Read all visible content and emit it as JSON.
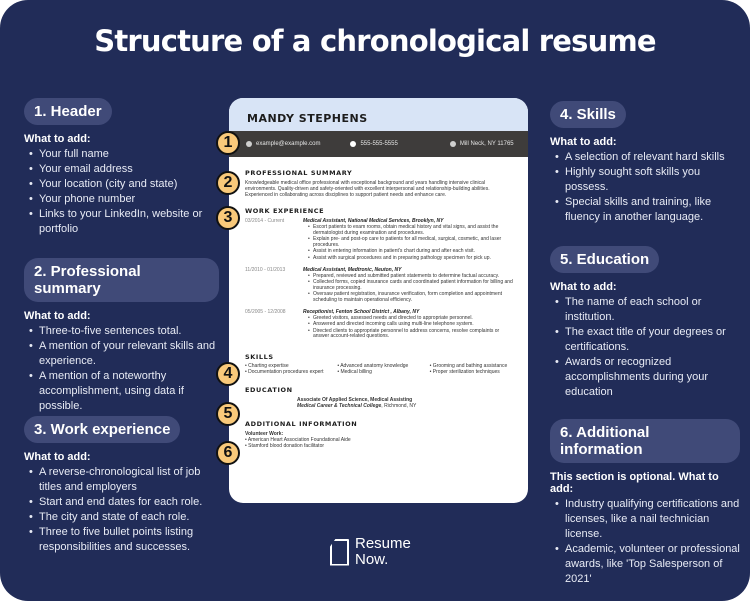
{
  "title": "Structure of a chronological resume",
  "panels": [
    {
      "heading": "1. Header",
      "intro": "What to add:",
      "items": [
        "Your full name",
        "Your email address",
        "Your location (city and state)",
        "Your phone number",
        "Links to your LinkedIn, website or portfolio"
      ]
    },
    {
      "heading": "2. Professional summary",
      "intro": "What to add:",
      "items": [
        "Three-to-five sentences total.",
        "A mention of your relevant skills and experience.",
        "A mention of a noteworthy accomplishment, using data if possible."
      ]
    },
    {
      "heading": "3. Work experience",
      "intro": "What to add:",
      "items": [
        "A reverse-chronological list of job titles and employers",
        "Start and end dates for each role.",
        "The city and state of each role.",
        "Three to five bullet points listing responsibilities and successes."
      ]
    },
    {
      "heading": "4. Skills",
      "intro": "What to add:",
      "items": [
        "A selection of relevant hard skills",
        "Highly sought soft skills you possess.",
        "Special skills and training, like fluency in another language."
      ]
    },
    {
      "heading": "5. Education",
      "intro": "What to add:",
      "items": [
        "The name of each school or institution.",
        "The exact title of your degrees or certifications.",
        "Awards or recognized accomplishments during your education"
      ]
    },
    {
      "heading": "6. Additional information",
      "intro": "This section is optional. What to add:",
      "items": [
        "Industry qualifying certifications and licenses, like a nail technician license.",
        "Academic, volunteer or professional awards, like 'Top Salesperson of 2021'"
      ]
    }
  ],
  "badges": [
    "1",
    "2",
    "3",
    "4",
    "5",
    "6"
  ],
  "resume": {
    "name": "MANDY STEPHENS",
    "email": "example@example.com",
    "phone": "555-555-5555",
    "location": "Mill Neck, NY 11765",
    "summary_heading": "PROFESSIONAL SUMMARY",
    "summary": "Knowledgeable medical office professional with exceptional background and years handling intensive clinical environments. Quality-driven and safety-oriented with excellent interpersonal and relationship-building abilities. Experienced in collaborating across disciplines to support patient needs and enhance care.",
    "work_heading": "WORK EXPERIENCE",
    "jobs": [
      {
        "dates": "03/2014 - Current",
        "title": "Medical Assistant, National Medical Services, Brooklyn, NY",
        "bullets": [
          "Escort patients to exam rooms, obtain medical history and vital signs, and assist the dermatologist during examination and procedures.",
          "Explain pre- and post-op care to patients for all medical, surgical, cosmetic, and laser procedures.",
          "Assist in entering information in patient's chart during and after each visit.",
          "Assist with surgical procedures and in preparing pathology specimen for pick up."
        ]
      },
      {
        "dates": "11/2010 - 01/2013",
        "title": "Medical Assistant, Medtronic, Neuton, NY",
        "bullets": [
          "Prepared, reviewed and submitted patient statements to determine factual accuracy.",
          "Collected forms, copied insurance cards and coordinated patient information for billing and insurance processing.",
          "Oversaw patient registration, insurance verification, form completion and appointment scheduling to maintain operational efficiency."
        ]
      },
      {
        "dates": "05/2005 - 12/2008",
        "title": "Receptionist, Fenton School District , Albany, NY",
        "bullets": [
          "Greeted visitors, assessed needs and directed to appropriate personnel.",
          "Answered and directed incoming calls using multi-line telephone system.",
          "Directed clients to appropriate personnel to address concerns, resolve complaints or answer account-related questions."
        ]
      }
    ],
    "skills_heading": "SKILLS",
    "skills": [
      "Charting expertise",
      "Advanced anatomy knowledge",
      "Grooming and bathing assistance",
      "Documentation procedures expert",
      "Medical billing",
      "Proper sterilization techniques"
    ],
    "education_heading": "EDUCATION",
    "degree": "Associate Of Applied Science, Medical Assisting",
    "school": "Medical Career & Technical College",
    "school_location": ", Richmond, NY",
    "additional_heading": "ADDITIONAL INFORMATION",
    "volunteer_label": "Volunteer Work:",
    "volunteer": [
      "American Heart Association Foundational Aide",
      "Stamford blood donation facilitator"
    ]
  },
  "logo": {
    "line1": "Resume",
    "line2": "Now."
  }
}
